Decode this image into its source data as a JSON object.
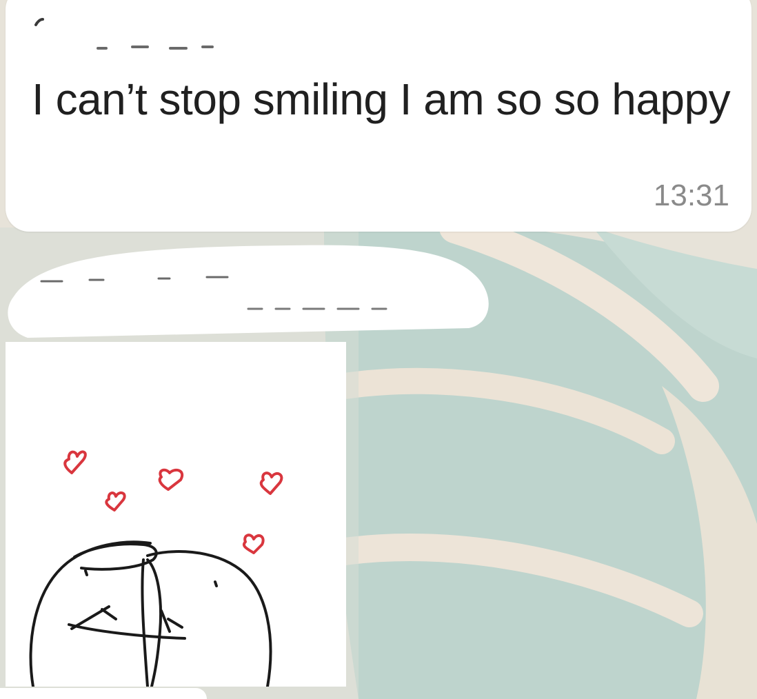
{
  "chat": {
    "message": {
      "text": "I can’t stop smiling I am so so happy",
      "time": "13:31"
    }
  },
  "colors": {
    "bubble": "#ffffff",
    "text": "#202020",
    "timestamp": "#8a8a8a",
    "wallpaper_leaf": "#bcd3cc",
    "wallpaper_cream": "#ece6da",
    "heart": "#d9363e",
    "sketch_line": "#1a1a1a"
  },
  "icons": {
    "sticker": "hugging-blobs-hearts-sticker"
  }
}
